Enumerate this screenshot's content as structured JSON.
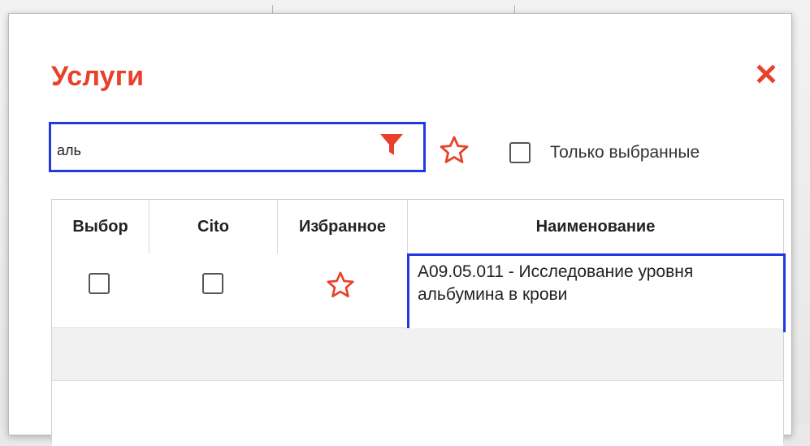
{
  "dialog": {
    "title": "Услуги",
    "close_icon": "close-icon",
    "accent_color": "#e8412b",
    "highlight_color": "#2238e0"
  },
  "search": {
    "value": "аль",
    "placeholder": "",
    "filter_icon": "filter-icon"
  },
  "favorites_toggle": {
    "icon": "star-outline-icon"
  },
  "only_selected": {
    "label": "Только выбранные",
    "checked": false
  },
  "table": {
    "columns": [
      "Выбор",
      "Cito",
      "Избранное",
      "Наименование"
    ],
    "rows": [
      {
        "selected": false,
        "cito": false,
        "favorite": false,
        "name": "A09.05.011 - Исследование уровня альбумина в крови"
      }
    ]
  }
}
